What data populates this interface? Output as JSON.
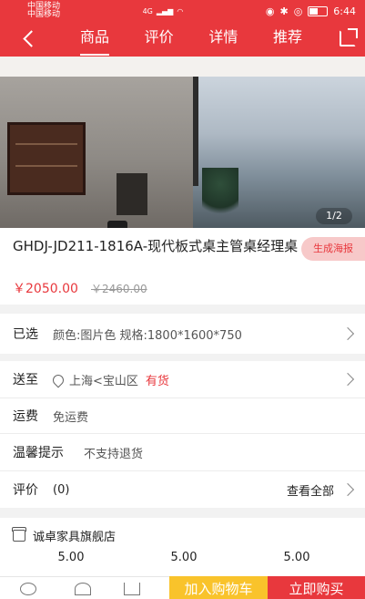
{
  "status_bar": {
    "carrier_1": "中国移动",
    "carrier_2": "中国移动",
    "network": "4G",
    "battery": "",
    "time": "6:44"
  },
  "header": {
    "tabs": [
      {
        "label": "商品",
        "active": true
      },
      {
        "label": "评价",
        "active": false
      },
      {
        "label": "详情",
        "active": false
      },
      {
        "label": "推荐",
        "active": false
      }
    ]
  },
  "gallery": {
    "pager": "1/2"
  },
  "product": {
    "title": "GHDJ-JD211-1816A-现代板式桌主管桌经理桌",
    "poster_button": "生成海报",
    "price": "￥2050.00",
    "original_price": "￥2460.00"
  },
  "selected": {
    "label": "已选",
    "value": "颜色:图片色 规格:1800*1600*750"
  },
  "shipping_to": {
    "label": "送至",
    "location": "上海<宝山区",
    "stock": "有货"
  },
  "freight": {
    "label": "运费",
    "value": "免运费"
  },
  "notice": {
    "label": "温馨提示",
    "value": "不支持退货"
  },
  "reviews": {
    "label": "评价",
    "count": "(0)",
    "view_all": "查看全部"
  },
  "store": {
    "name": "诚卓家具旗舰店",
    "scores": [
      "5.00",
      "5.00",
      "5.00"
    ]
  },
  "bottom_bar": {
    "add_to_cart": "加入购物车",
    "buy_now": "立即购买"
  },
  "colors": {
    "brand_red": "#e8383d",
    "cart_yellow": "#f9c32b"
  }
}
